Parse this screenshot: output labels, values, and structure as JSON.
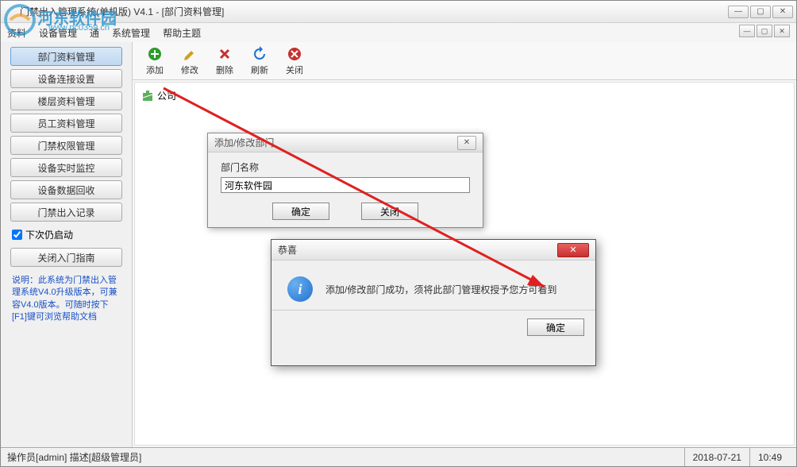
{
  "window": {
    "title": "门禁出入管理系统(单机版)  V4.1 - [部门资料管理]"
  },
  "menu": {
    "items": [
      "资料",
      "设备管理",
      "通",
      "系统管理",
      "帮助主题"
    ]
  },
  "watermark": {
    "text": "河东软件园",
    "url": "www.pc0359.cn"
  },
  "sidebar": {
    "buttons": [
      "部门资料管理",
      "设备连接设置",
      "楼层资料管理",
      "员工资料管理",
      "门禁权限管理",
      "设备实时监控",
      "设备数据回收",
      "门禁出入记录"
    ],
    "checkbox": "下次仍启动",
    "last_button": "关闭入门指南",
    "info": "说明：此系统为门禁出入管理系统V4.0升级版本，可兼容V4.0版本。可随时按下[F1]键可浏览帮助文档"
  },
  "toolbar": {
    "items": [
      {
        "label": "添加",
        "color": "#2c9c2c"
      },
      {
        "label": "修改",
        "color": "#d0a020"
      },
      {
        "label": "删除",
        "color": "#c83030"
      },
      {
        "label": "刷新",
        "color": "#2070d0"
      },
      {
        "label": "关闭",
        "color": "#c83030"
      }
    ]
  },
  "tree": {
    "root": "公司"
  },
  "dialog1": {
    "title": "添加/修改部门",
    "field_label": "部门名称",
    "field_value": "河东软件园",
    "ok": "确定",
    "cancel": "关闭"
  },
  "dialog2": {
    "title": "恭喜",
    "message": "添加/修改部门成功，须将此部门管理权授予您方可看到",
    "ok": "确定"
  },
  "status": {
    "left": "操作员[admin]   描述[超级管理员]",
    "date": "2018-07-21",
    "time": "10:49"
  }
}
